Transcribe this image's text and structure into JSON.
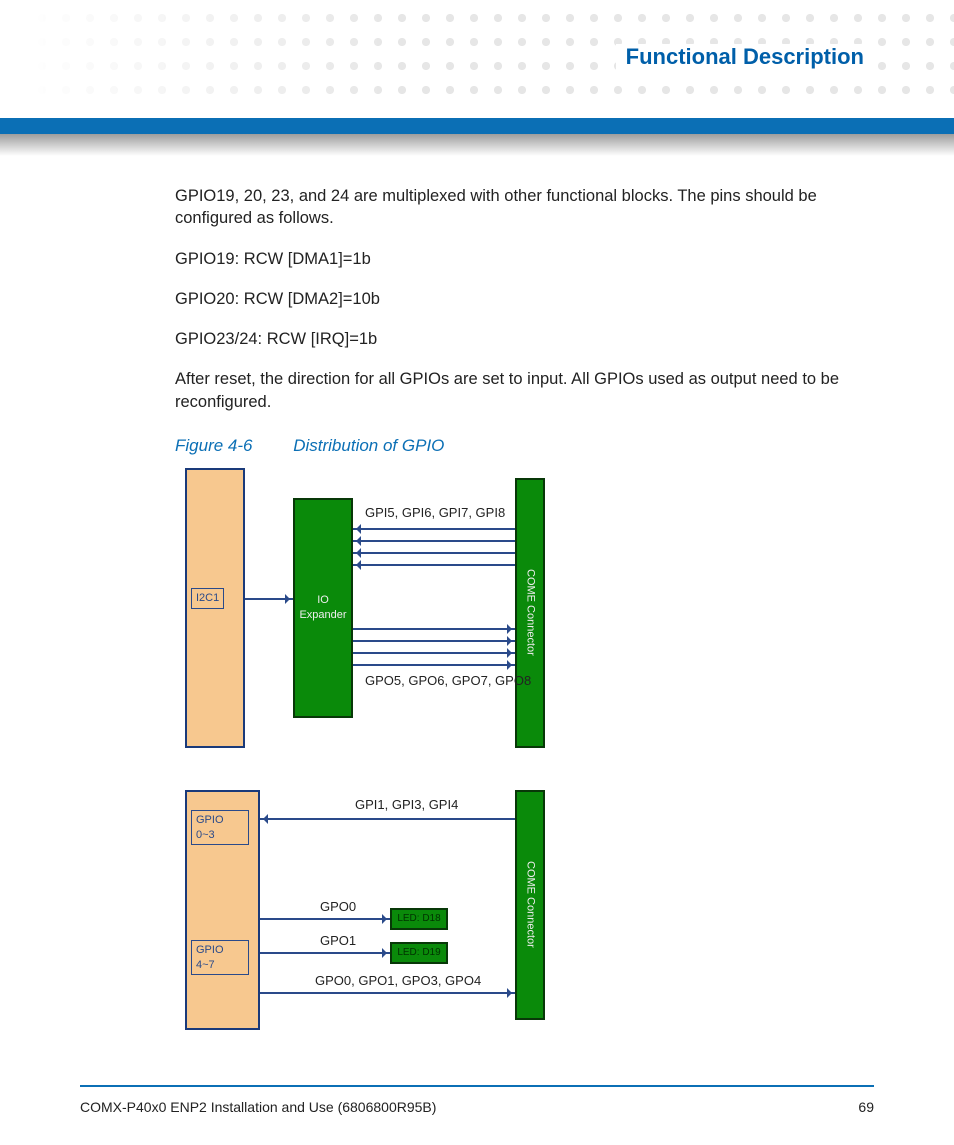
{
  "header": {
    "title": "Functional Description"
  },
  "body": {
    "p1": "GPIO19, 20, 23, and 24 are multiplexed with other functional blocks. The pins should be configured as follows.",
    "p2": "GPIO19: RCW [DMA1]=1b",
    "p3": "GPIO20: RCW [DMA2]=10b",
    "p4": "GPIO23/24: RCW [IRQ]=1b",
    "p5": "After reset, the direction for all GPIOs are set to input. All GPIOs used as output need to be reconfigured."
  },
  "figure": {
    "number": "Figure 4-6",
    "title": "Distribution of GPIO"
  },
  "diagram1": {
    "i2c1": "I2C1",
    "io_expander": "IO Expander",
    "come": "COME Connector",
    "top_signals": "GPI5, GPI6, GPI7, GPI8",
    "bottom_signals": "GPO5, GPO6, GPO7, GPO8"
  },
  "diagram2": {
    "gpio_top": "GPIO 0~3",
    "gpio_bottom": "GPIO 4~7",
    "come": "COME Connector",
    "in_signals": "GPI1, GPI3, GPI4",
    "gpo0": "GPO0",
    "gpo1": "GPO1",
    "led1": "LED: D18",
    "led2": "LED: D19",
    "out_signals": "GPO0, GPO1, GPO3, GPO4"
  },
  "footer": {
    "doc": "COMX-P40x0 ENP2 Installation and Use (6806800R95B)",
    "page": "69"
  }
}
